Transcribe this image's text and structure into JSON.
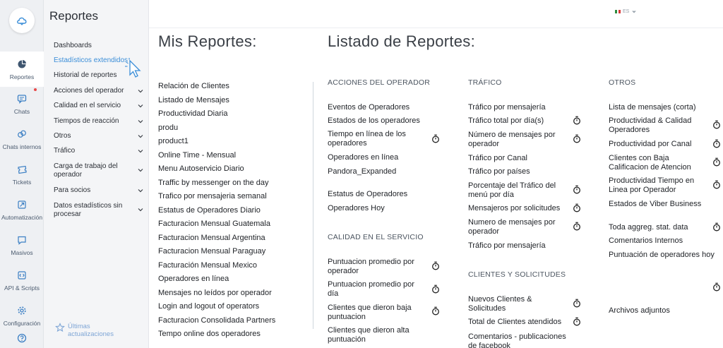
{
  "rail": {
    "items": [
      {
        "label": "Reportes",
        "icon": "pie-chart-icon"
      },
      {
        "label": "Chats",
        "icon": "chat-icon"
      },
      {
        "label": "Chats internos",
        "icon": "internal-chat-icon"
      },
      {
        "label": "Tickets",
        "icon": "ticket-icon"
      },
      {
        "label": "Automatización",
        "icon": "automation-icon"
      },
      {
        "label": "Masivos",
        "icon": "broadcast-icon"
      },
      {
        "label": "API & Scripts",
        "icon": "code-icon"
      },
      {
        "label": "Configuración",
        "icon": "gear-icon"
      }
    ],
    "active": "Reportes"
  },
  "subnav": {
    "title": "Reportes",
    "items": [
      {
        "label": "Dashboards",
        "expandable": false
      },
      {
        "label": "Estadísticos extendidos",
        "expandable": false
      },
      {
        "label": "Historial de reportes",
        "expandable": false
      },
      {
        "label": "Acciones del operador",
        "expandable": true
      },
      {
        "label": "Calidad en el servicio",
        "expandable": true
      },
      {
        "label": "Tiempos de reacción",
        "expandable": true
      },
      {
        "label": "Otros",
        "expandable": true
      },
      {
        "label": "Tráfico",
        "expandable": true
      },
      {
        "label": "Carga de trabajo del operador",
        "expandable": true
      },
      {
        "label": "Para socios",
        "expandable": true
      },
      {
        "label": "Datos estadísticos sin procesar",
        "expandable": true
      }
    ],
    "updates_label": "Últimas actualizaciones"
  },
  "topbar": {
    "language": "ES",
    "colors": {
      "flag_left": "#2e8b3d",
      "flag_mid": "#ffffff",
      "flag_right": "#d93a3a"
    }
  },
  "mis_reportes": {
    "title": "Mis Reportes:",
    "items": [
      "Relación de Clientes",
      "Listado de Mensajes",
      "Productividad Diaria",
      "produ",
      "product1",
      "Online Time - Mensual",
      "Menu Autoservicio Diario",
      "Traffic by messenger on the day",
      "Trafico por mensajeria semanal",
      "Estatus de Operadores Diario",
      "Facturacion Mensual Guatemala",
      "Facturacion Mensual Argentina",
      "Facturacion Mensual Paraguay",
      "Facturación Mensual Mexico",
      "Operadores en línea",
      "Mensajes no leídos por operador",
      "Login and logout of operators",
      "Facturacion Consolidada Partners",
      "Tempo online dos operadores"
    ]
  },
  "listado": {
    "title": "Listado de Reportes:",
    "acciones_operador": {
      "heading": "ACCIONES DEL OPERADOR",
      "items": [
        {
          "label": "Eventos de Operadores",
          "timer": false
        },
        {
          "label": "Estados de los operadores",
          "timer": false
        },
        {
          "label": "Tiempo en línea de los operadores",
          "timer": true
        },
        {
          "label": "Operadores en línea",
          "timer": false
        },
        {
          "label": "Pandora_Expanded",
          "timer": false
        },
        {
          "label": "Estatus de Operadores",
          "timer": false
        },
        {
          "label": "Operadores Hoy",
          "timer": false
        }
      ]
    },
    "calidad_servicio": {
      "heading": "CALIDAD EN EL SERVICIO",
      "items": [
        {
          "label": "Puntuacion promedio por operador",
          "timer": true
        },
        {
          "label": "Puntuacion promedio por día",
          "timer": true
        },
        {
          "label": "Clientes que dieron baja puntuacion",
          "timer": true
        },
        {
          "label": "Clientes que dieron alta puntuación",
          "timer": false
        }
      ]
    },
    "trafico": {
      "heading": "TRÁFICO",
      "items": [
        {
          "label": "Tráfico por mensajería",
          "timer": false
        },
        {
          "label": "Tráfico total por día(s)",
          "timer": true
        },
        {
          "label": "Número de mensajes por operador",
          "timer": true
        },
        {
          "label": "Tráfico por Canal",
          "timer": false
        },
        {
          "label": "Tráfico por países",
          "timer": false
        },
        {
          "label": "Porcentaje del Tráfico del menú por día",
          "timer": true
        },
        {
          "label": "Mensajeros por solicitudes",
          "timer": true
        },
        {
          "label": "Numero de mensajes por operador",
          "timer": true
        },
        {
          "label": "Tráfico por mensajería",
          "timer": false
        }
      ]
    },
    "clientes_solicitudes": {
      "heading": "CLIENTES Y SOLICITUDES",
      "items": [
        {
          "label": "Nuevos Clientes & Solicitudes",
          "timer": true
        },
        {
          "label": "Total de Clientes atendidos",
          "timer": true
        },
        {
          "label": "Comentarios - publicaciones de facebook",
          "timer": false
        }
      ]
    },
    "otros": {
      "heading": "OTROS",
      "items": [
        {
          "label": "Lista de mensajes (corta)",
          "timer": false
        },
        {
          "label": "Productividad & Calidad Operadores",
          "timer": true
        },
        {
          "label": "Productividad por Canal",
          "timer": true
        },
        {
          "label": "Clientes con Baja Calificacion de Atencion",
          "timer": true
        },
        {
          "label": "Productividad Tiempo en Linea por Operador",
          "timer": true
        },
        {
          "label": "Estados de Viber Business",
          "timer": false
        },
        {
          "label": "Toda aggreg. stat. data",
          "timer": true
        },
        {
          "label": "Comentarios Internos",
          "timer": false
        },
        {
          "label": "Puntuación de operadores hoy",
          "timer": false
        },
        {
          "label": "",
          "timer": true
        },
        {
          "label": "Archivos adjuntos",
          "timer": false
        }
      ]
    }
  },
  "colors": {
    "accent": "#3b8ed8",
    "rail_bg": "#eef0f3",
    "subnav_bg": "#f4f5f7"
  }
}
